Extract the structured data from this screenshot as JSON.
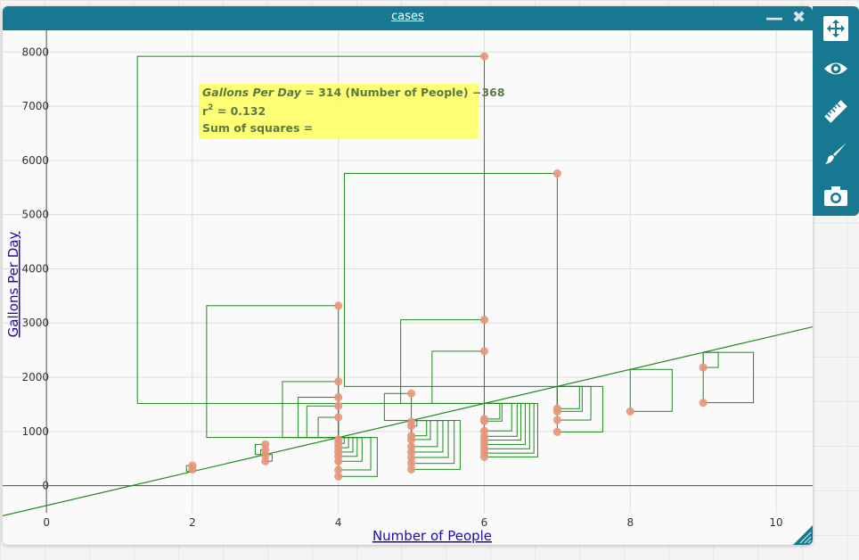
{
  "window": {
    "title": "cases"
  },
  "toolbar": {
    "tools": [
      "move-icon",
      "eye-icon",
      "ruler-icon",
      "brush-icon",
      "camera-icon"
    ]
  },
  "colors": {
    "titlebar": "#177991",
    "point": "#e8957a",
    "squares": "#1f8a1f",
    "line": "#1f8a1f",
    "equation_bg": "#ffff66",
    "equation_text": "#5a7a45"
  },
  "equation": {
    "line1_prefix": "Gallons Per Day",
    "line1_rest": " = 314 (Number of People) −368",
    "r2_label": "r",
    "r2_sup": "2",
    "r2_value": " = 0.132",
    "sum_squares": "Sum of squares ="
  },
  "chart_data": {
    "type": "scatter",
    "xlabel": "Number of People",
    "ylabel": "Gallons Per Day",
    "xlim": [
      -0.6,
      10.5
    ],
    "ylim": [
      -500,
      8400
    ],
    "grid": true,
    "x_ticks": [
      0,
      2,
      4,
      6,
      8,
      10
    ],
    "y_ticks": [
      0,
      1000,
      2000,
      3000,
      4000,
      5000,
      6000,
      7000,
      8000
    ],
    "regression": {
      "slope": 314,
      "intercept": -368,
      "r_squared": 0.132
    },
    "show_squares": true,
    "points": [
      [
        2,
        370
      ],
      [
        2,
        300
      ],
      [
        3,
        760
      ],
      [
        3,
        660
      ],
      [
        3,
        560
      ],
      [
        3,
        450
      ],
      [
        4,
        3320
      ],
      [
        4,
        1920
      ],
      [
        4,
        1630
      ],
      [
        4,
        1470
      ],
      [
        4,
        1260
      ],
      [
        4,
        850
      ],
      [
        4,
        780
      ],
      [
        4,
        700
      ],
      [
        4,
        620
      ],
      [
        4,
        540
      ],
      [
        4,
        450
      ],
      [
        4,
        290
      ],
      [
        4,
        170
      ],
      [
        5,
        1700
      ],
      [
        5,
        1180
      ],
      [
        5,
        1100
      ],
      [
        5,
        920
      ],
      [
        5,
        850
      ],
      [
        5,
        720
      ],
      [
        5,
        620
      ],
      [
        5,
        520
      ],
      [
        5,
        410
      ],
      [
        5,
        300
      ],
      [
        6,
        7920
      ],
      [
        6,
        3060
      ],
      [
        6,
        2480
      ],
      [
        6,
        1230
      ],
      [
        6,
        1190
      ],
      [
        6,
        1010
      ],
      [
        6,
        910
      ],
      [
        6,
        840
      ],
      [
        6,
        760
      ],
      [
        6,
        680
      ],
      [
        6,
        600
      ],
      [
        6,
        530
      ],
      [
        7,
        5760
      ],
      [
        7,
        1420
      ],
      [
        7,
        1370
      ],
      [
        7,
        1210
      ],
      [
        7,
        990
      ],
      [
        8,
        1370
      ],
      [
        9,
        2180
      ],
      [
        9,
        1530
      ]
    ]
  }
}
